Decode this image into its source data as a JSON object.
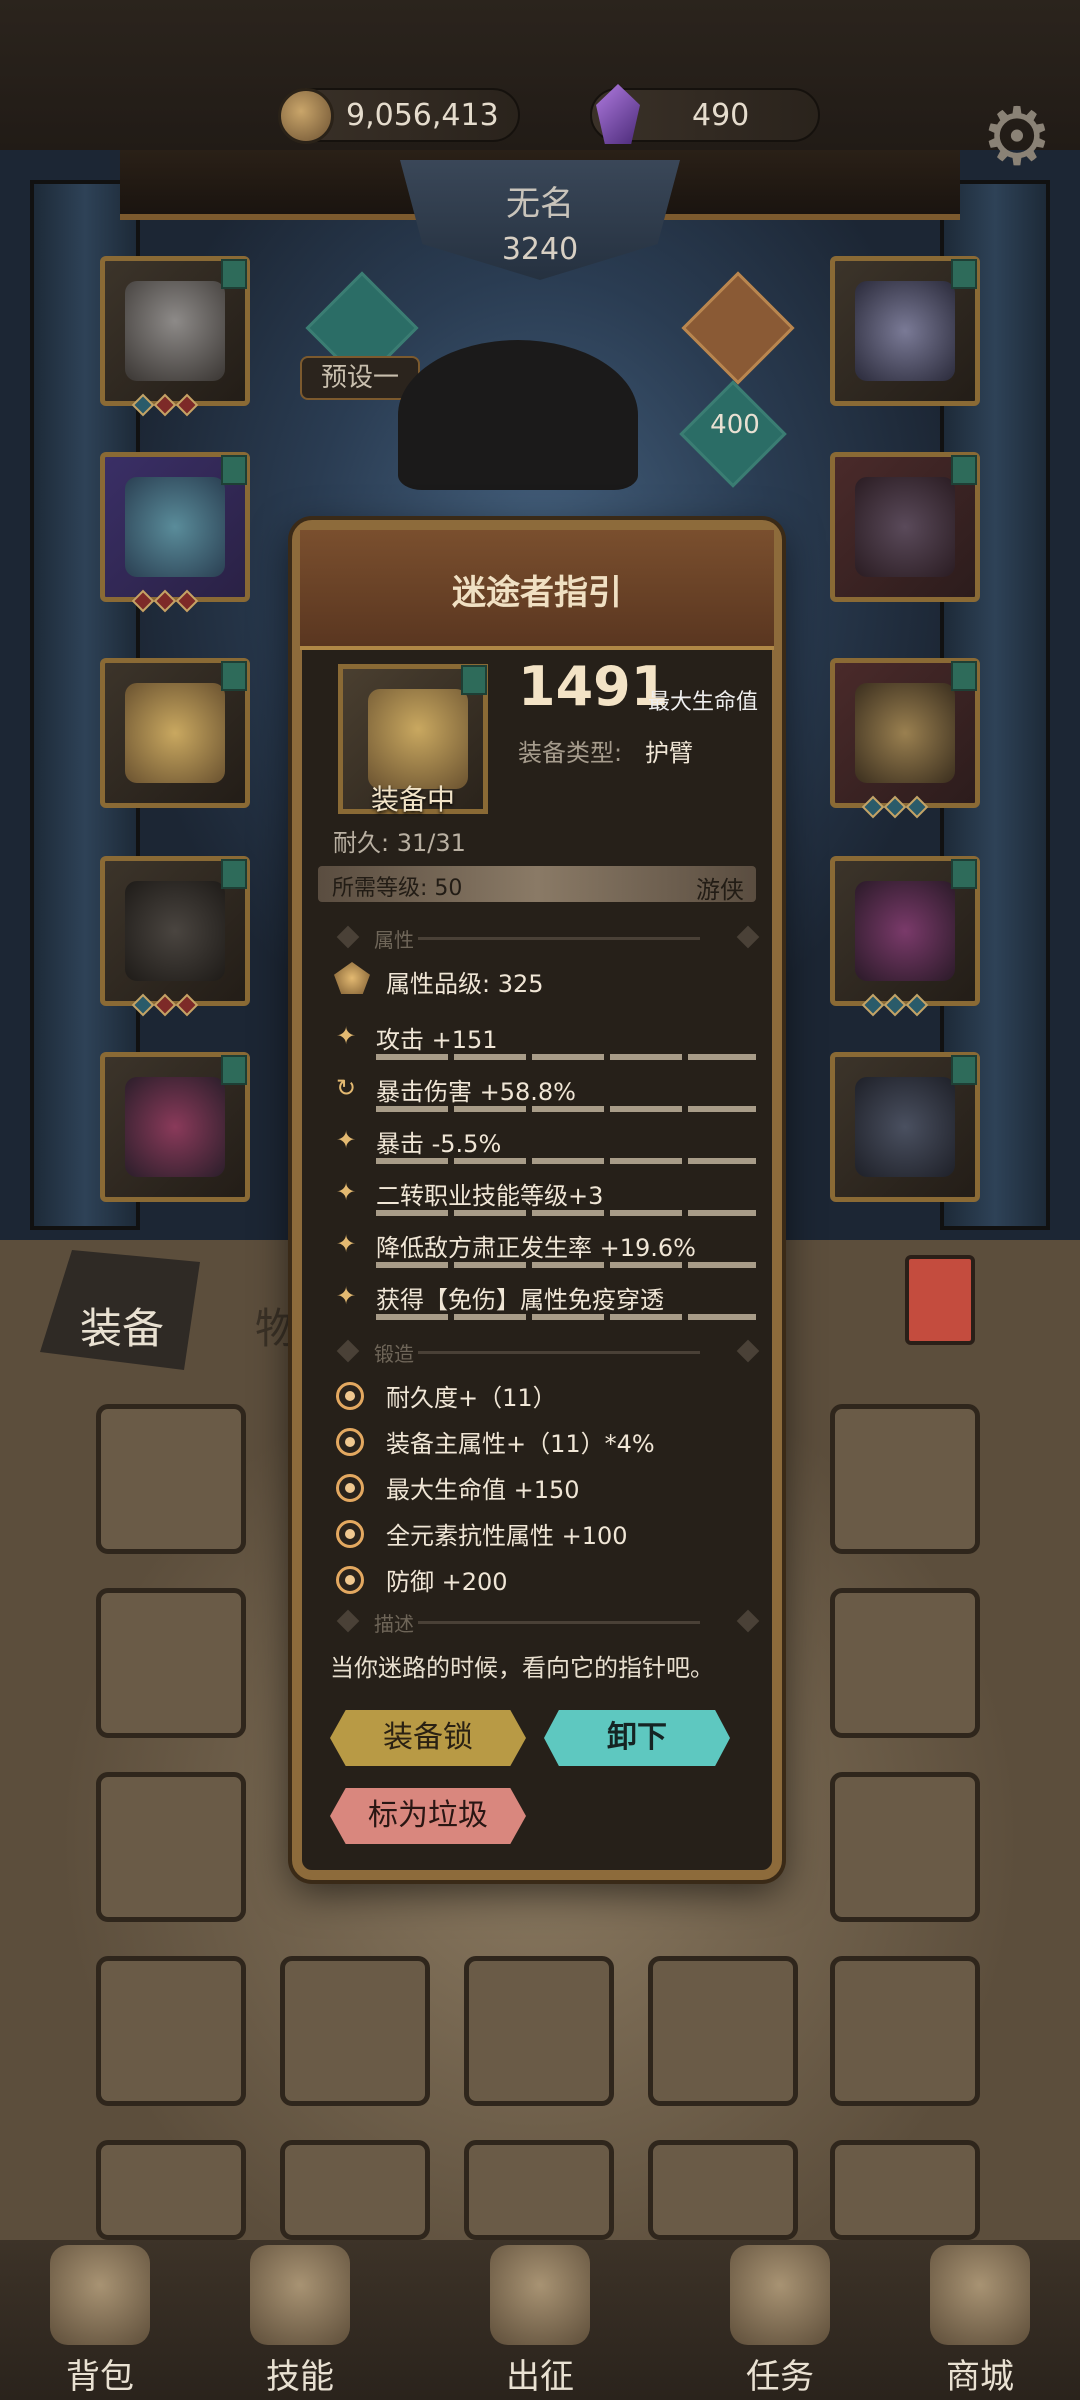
{
  "currency": {
    "gold": "9,056,413",
    "gems": "490"
  },
  "icons": {
    "gold": "gold-coin-icon",
    "gem": "purple-crystal-icon",
    "settings": "gear-icon"
  },
  "character": {
    "name": "无名",
    "power": "3240",
    "preset": "预设一",
    "level_badge": "400"
  },
  "item": {
    "name": "迷途者指引",
    "main_value": "1491",
    "main_label": "最大生命值",
    "type_label": "装备类型:",
    "type_value": "护臂",
    "status": "装备中",
    "durability": "耐久: 31/31",
    "required_level": "所需等级: 50",
    "required_class": "游侠",
    "section_attributes": "属性",
    "grade": "属性品级: 325",
    "attributes": [
      "攻击 +151",
      "暴击伤害 +58.8%",
      "暴击 -5.5%",
      "二转职业技能等级+3",
      "降低敌方肃正发生率 +19.6%",
      "获得【免伤】属性免疫穿透"
    ],
    "section_forge": "锻造",
    "forge": [
      "耐久度+（11）",
      "装备主属性+（11）*4%",
      "最大生命值 +150",
      "全元素抗性属性 +100",
      "防御 +200"
    ],
    "section_desc": "描述",
    "description": "当你迷路的时候，看向它的指针吧。",
    "buttons": {
      "lock": "装备锁",
      "unequip": "卸下",
      "mark_trash": "标为垃圾"
    }
  },
  "bag_tabs": {
    "equipment": "装备",
    "items": "物品"
  },
  "nav": [
    "背包",
    "技能",
    "出征",
    "任务",
    "商城"
  ],
  "accent_colors": {
    "gold_frame": "#8d6b3b",
    "teal": "#5ec8c0",
    "red": "#c44c3e"
  }
}
